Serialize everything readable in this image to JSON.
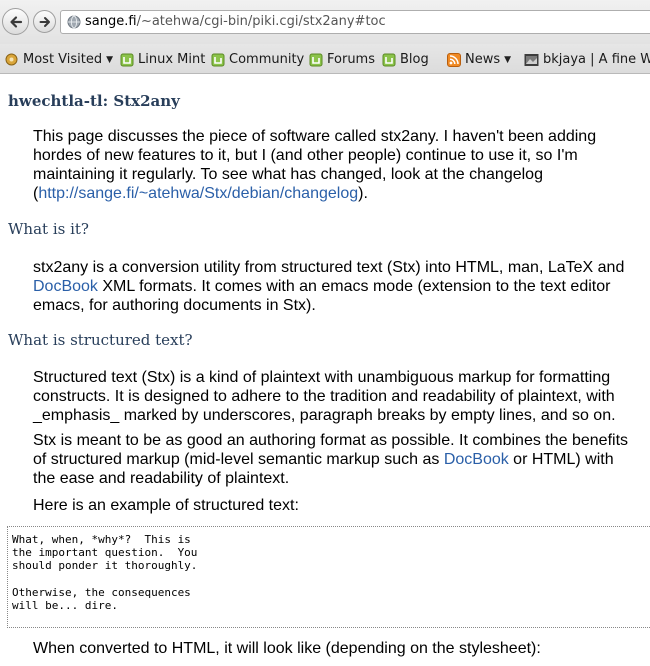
{
  "browser": {
    "url_host": "sange.fi",
    "url_path": "/~atehwa/cgi-bin/piki.cgi/stx2any#toc"
  },
  "bookmarks": [
    {
      "label": "Most Visited",
      "icon": "gear-icon",
      "dropdown": true
    },
    {
      "label": "Linux Mint",
      "icon": "mint-icon",
      "dropdown": false
    },
    {
      "label": "Community",
      "icon": "mint-icon",
      "dropdown": false
    },
    {
      "label": "Forums",
      "icon": "mint-icon",
      "dropdown": false
    },
    {
      "label": "Blog",
      "icon": "mint-icon",
      "dropdown": false
    },
    {
      "label": "News",
      "icon": "rss-icon",
      "dropdown": true
    },
    {
      "label": "bkjaya | A fine Wo",
      "icon": "site-icon",
      "dropdown": false
    }
  ],
  "page": {
    "title": "hwechtla-tl: Stx2any",
    "intro": {
      "text": "This page discusses the piece of software called stx2any. I haven't been adding hordes of new features to it, but I (and other people) continue to use it, so I'm maintaining it regularly. To see what has changed, look at the changelog (",
      "link": "http://sange.fi/~atehwa/Stx/debian/changelog",
      "after": ")."
    },
    "what_heading": "What is it?",
    "what_text": {
      "before": "stx2any is a conversion utility from structured text (Stx) into HTML, man, LaTeX and ",
      "link": "DocBook",
      "after": " XML formats. It comes with an emacs mode (extension to the text editor emacs, for authoring documents in Stx)."
    },
    "structured_heading": "What is structured text?",
    "structured_p1": "Structured text (Stx) is a kind of plaintext with unambiguous markup for formatting constructs. It is designed to adhere to the tradition and readability of plaintext, with _emphasis_ marked by underscores, paragraph breaks by empty lines, and so on.",
    "structured_p2": {
      "before": "Stx is meant to be as good an authoring format as possible. It combines the benefits of structured markup (mid-level semantic markup such as ",
      "link": "DocBook",
      "after": " or HTML) with the ease and readability of plaintext."
    },
    "example_intro": "Here is an example of structured text:",
    "code_example": "What, when, *why*?  This is\nthe important question.  You\nshould ponder it thoroughly.\n\nOtherwise, the consequences\nwill be... dire.",
    "converted_text": "When converted to HTML, it will look like (depending on the stylesheet):"
  },
  "colors": {
    "heading": "#283e5a",
    "link": "#2a5fa8"
  }
}
